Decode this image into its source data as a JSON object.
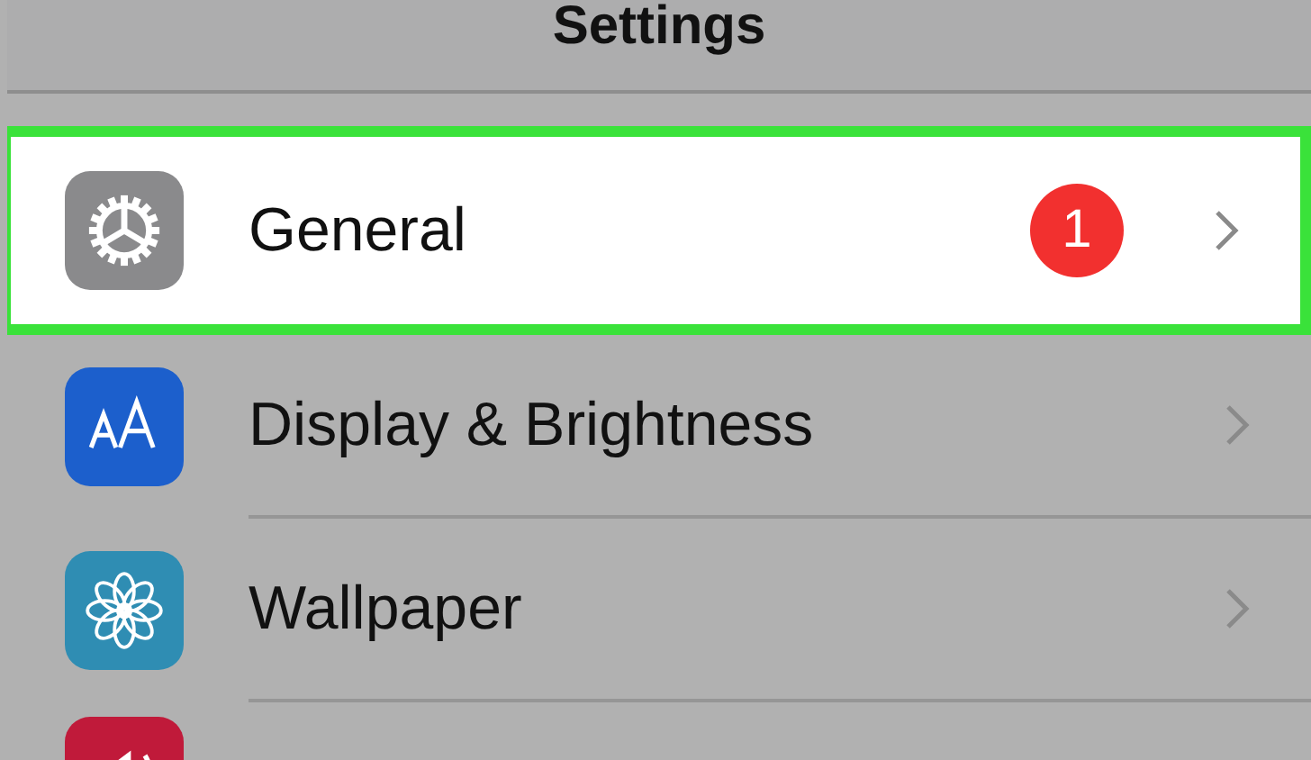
{
  "navigation_bar": {
    "title": "Settings"
  },
  "items": [
    {
      "kind": "gear",
      "label": "General",
      "badge": "1",
      "selected": true
    },
    {
      "kind": "text-size",
      "label": "Display & Brightness",
      "selected": false
    },
    {
      "kind": "flower",
      "label": "Wallpaper",
      "selected": false
    },
    {
      "kind": "speaker",
      "selected": false
    }
  ]
}
